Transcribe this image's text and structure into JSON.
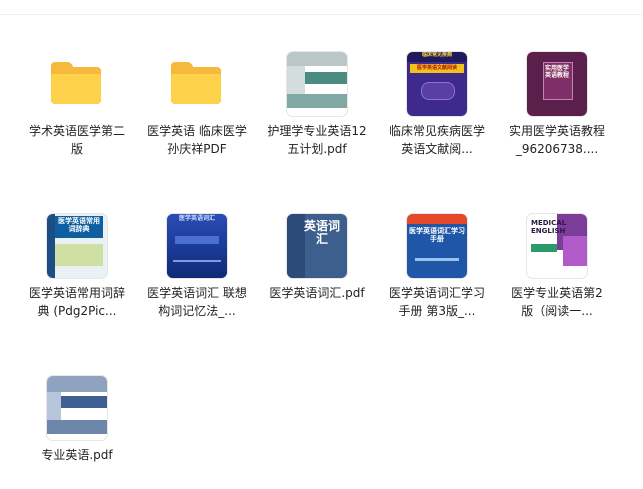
{
  "items": [
    {
      "name": "学术英语医学第二版",
      "kind": "folder-icon"
    },
    {
      "name": "医学英语 临床医学 孙庆祥PDF",
      "kind": "folder-icon"
    },
    {
      "name": "护理学专业英语12五计划.pdf",
      "kind": "book-cover-icon"
    },
    {
      "name": "临床常见疾病医学英语文献阅...",
      "kind": "book-cover-icon",
      "cover_title": "临床常见疾病",
      "cover_sub": "医学英语文献阅读"
    },
    {
      "name": "实用医学英语教程_96206738....",
      "kind": "book-cover-icon",
      "cover_title": "实用医学英语教程"
    },
    {
      "name": "医学英语常用词辞典 (Pdg2Pic...",
      "kind": "book-cover-icon",
      "cover_title": "医学英语常用词辞典"
    },
    {
      "name": "医学英语词汇 联想构词记忆法_...",
      "kind": "book-cover-icon",
      "cover_title": "医学英语词汇"
    },
    {
      "name": "医学英语词汇.pdf",
      "kind": "book-cover-icon",
      "cover_title": "英语词汇"
    },
    {
      "name": "医学英语词汇学习手册 第3版_...",
      "kind": "book-cover-icon",
      "cover_title": "医学英语词汇学习手册"
    },
    {
      "name": "医学专业英语第2版（阅读一...",
      "kind": "book-cover-icon",
      "cover_title": "MEDICAL ENGLISH"
    },
    {
      "name": "专业英语.pdf",
      "kind": "book-cover-icon"
    }
  ]
}
